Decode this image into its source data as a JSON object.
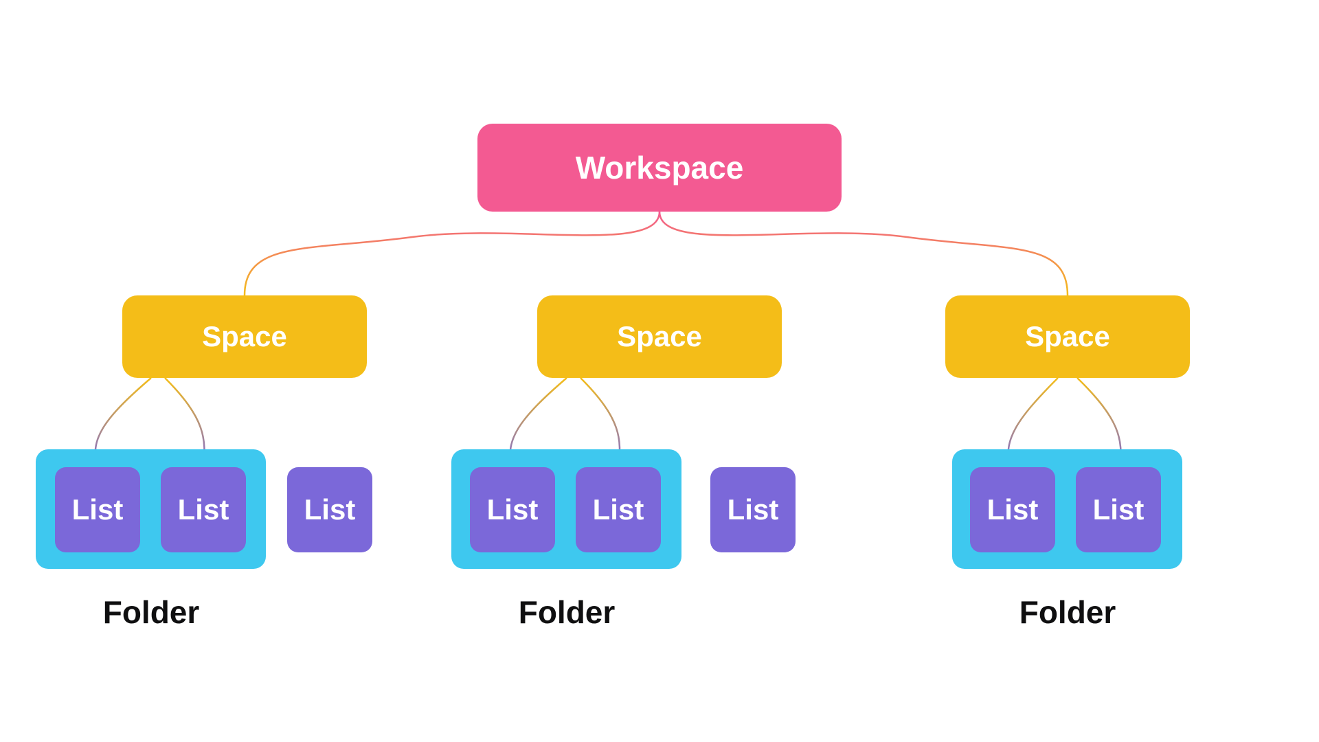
{
  "colors": {
    "workspace": "#f35a92",
    "space": "#f4bd18",
    "folder_box": "#3ec8ef",
    "list": "#7b68d9",
    "text_dark": "#0f0f10",
    "text_light": "#ffffff"
  },
  "hierarchy": {
    "workspace": {
      "label": "Workspace"
    },
    "spaces": [
      {
        "label": "Space",
        "folder": {
          "label": "Folder",
          "lists": [
            {
              "label": "List"
            },
            {
              "label": "List"
            }
          ]
        },
        "loose_lists": [
          {
            "label": "List"
          }
        ]
      },
      {
        "label": "Space",
        "folder": {
          "label": "Folder",
          "lists": [
            {
              "label": "List"
            },
            {
              "label": "List"
            }
          ]
        },
        "loose_lists": [
          {
            "label": "List"
          }
        ]
      },
      {
        "label": "Space",
        "folder": {
          "label": "Folder",
          "lists": [
            {
              "label": "List"
            },
            {
              "label": "List"
            }
          ]
        },
        "loose_lists": []
      }
    ]
  }
}
